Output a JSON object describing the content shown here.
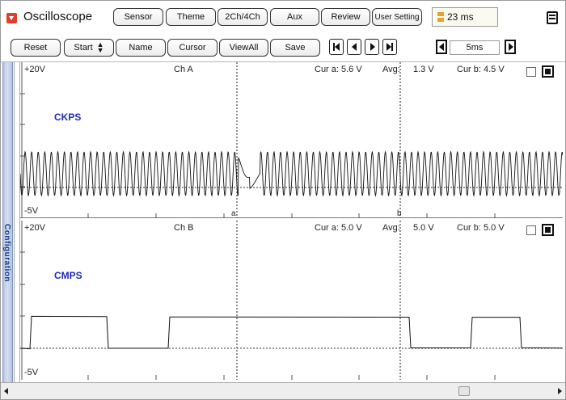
{
  "app": {
    "title": "Oscilloscope"
  },
  "toolbar_top": {
    "buttons": [
      "Sensor",
      "Theme",
      "2Ch/4Ch",
      "Aux",
      "Review",
      "User Setting"
    ],
    "timer_value": "23 ms"
  },
  "toolbar_second": {
    "reset": "Reset",
    "start": "Start",
    "name": "Name",
    "cursor": "Cursor",
    "viewall": "ViewAll",
    "save": "Save",
    "timebase": "5ms"
  },
  "sidebar": {
    "label": "Configuration"
  },
  "channels": [
    {
      "name": "Ch A",
      "top_scale": "+20V",
      "bottom_scale": "-5V",
      "cur_a": "Cur a: 5.6 V",
      "avg": "Avg:",
      "avg_value": "1.3 V",
      "cur_b": "Cur b: 4.5 V",
      "signal": "CKPS",
      "cursor_a_label": "a",
      "cursor_b_label": "b"
    },
    {
      "name": "Ch B",
      "top_scale": "+20V",
      "bottom_scale": "-5V",
      "cur_a": "Cur a: 5.0 V",
      "avg": "Avg:",
      "avg_value": "5.0 V",
      "cur_b": "Cur b: 5.0 V",
      "signal": "CMPS"
    }
  ],
  "colors": {
    "signal_label": "#1f2ab8",
    "menu_accent": "#d9412b",
    "sidebar": "#b6c4e4",
    "timer_icon": "#e8a32a"
  },
  "icons": [
    "menu-dropdown-icon",
    "ab-timer-icon",
    "panel-toggle-icon",
    "first-icon",
    "prev-icon",
    "next-icon",
    "last-icon",
    "time-decrease-icon",
    "time-increase-icon"
  ]
}
